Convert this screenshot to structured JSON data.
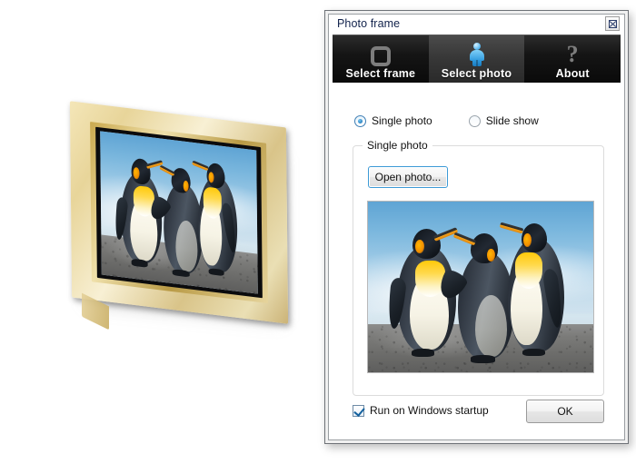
{
  "window": {
    "title": "Photo frame",
    "close_button": "close-icon"
  },
  "tabs": [
    {
      "label": "Select frame",
      "icon": "rounded-square-icon",
      "active": false
    },
    {
      "label": "Select photo",
      "icon": "person-icon",
      "active": true
    },
    {
      "label": "About",
      "icon": "question-mark-icon",
      "active": false
    }
  ],
  "mode": {
    "single_photo_label": "Single photo",
    "slide_show_label": "Slide show",
    "selected": "Single photo"
  },
  "group": {
    "title": "Single photo",
    "open_button": "Open photo...",
    "preview_alt": "Three king penguins on a beach"
  },
  "footer": {
    "startup_checkbox_label": "Run on Windows startup",
    "startup_checked": true,
    "ok_button": "OK"
  },
  "artwork": {
    "description": "Gold picture frame standing at an angle showing the penguin photo"
  },
  "colors": {
    "accent_blue": "#3c9ad6",
    "tabstrip_dark": "#0a0a0a",
    "title_text": "#11224b",
    "frame_gold": "#e8d59a",
    "icon_blue": "#2e9ade"
  }
}
